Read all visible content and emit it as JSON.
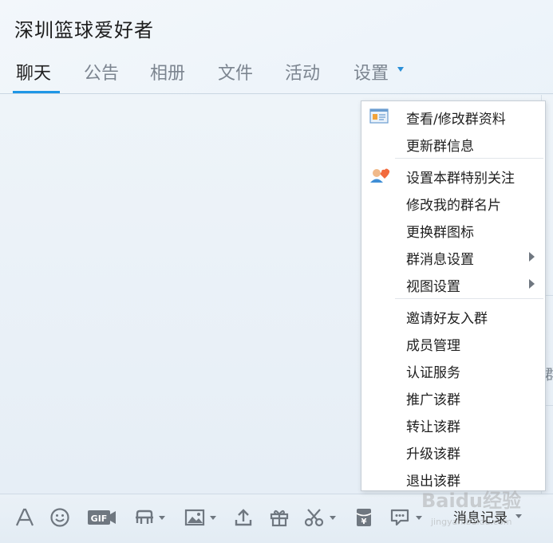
{
  "window": {
    "title": "深圳篮球爱好者"
  },
  "tabs": [
    {
      "label": "聊天",
      "active": true
    },
    {
      "label": "公告",
      "active": false
    },
    {
      "label": "相册",
      "active": false
    },
    {
      "label": "文件",
      "active": false
    },
    {
      "label": "活动",
      "active": false
    },
    {
      "label": "设置",
      "active": false
    }
  ],
  "settings_menu": {
    "items": [
      {
        "label": "查看/修改群资料",
        "icon": "group-profile-icon"
      },
      {
        "label": "更新群信息"
      },
      {
        "label": "设置本群特别关注",
        "icon": "special-attention-icon"
      },
      {
        "label": "修改我的群名片"
      },
      {
        "label": "更换群图标"
      },
      {
        "label": "群消息设置",
        "submenu": true
      },
      {
        "label": "视图设置",
        "submenu": true
      },
      {
        "label": "邀请好友入群"
      },
      {
        "label": "成员管理"
      },
      {
        "label": "认证服务"
      },
      {
        "label": "推广该群"
      },
      {
        "label": "转让该群"
      },
      {
        "label": "升级该群"
      },
      {
        "label": "退出该群"
      }
    ]
  },
  "right_panel": {
    "fragment": "群"
  },
  "toolbar": {
    "tools": [
      {
        "name": "font-icon"
      },
      {
        "name": "emoji-icon"
      },
      {
        "name": "gif-icon",
        "text": "GIF"
      },
      {
        "name": "screenshot-icon",
        "dropdown": true
      },
      {
        "name": "image-icon",
        "dropdown": true
      },
      {
        "name": "upload-icon"
      },
      {
        "name": "gift-icon"
      },
      {
        "name": "scissors-icon",
        "dropdown": true
      },
      {
        "name": "red-packet-icon",
        "text": "¥"
      },
      {
        "name": "chat-bubble-icon",
        "dropdown": true
      }
    ],
    "history_label": "消息记录"
  },
  "watermark": {
    "text": "Baidu经验",
    "url_text": "jingyan.baidu.com"
  },
  "colors": {
    "accent": "#1e96e6",
    "tab_inactive": "#7c8590",
    "menu_bg": "#ffffff"
  }
}
